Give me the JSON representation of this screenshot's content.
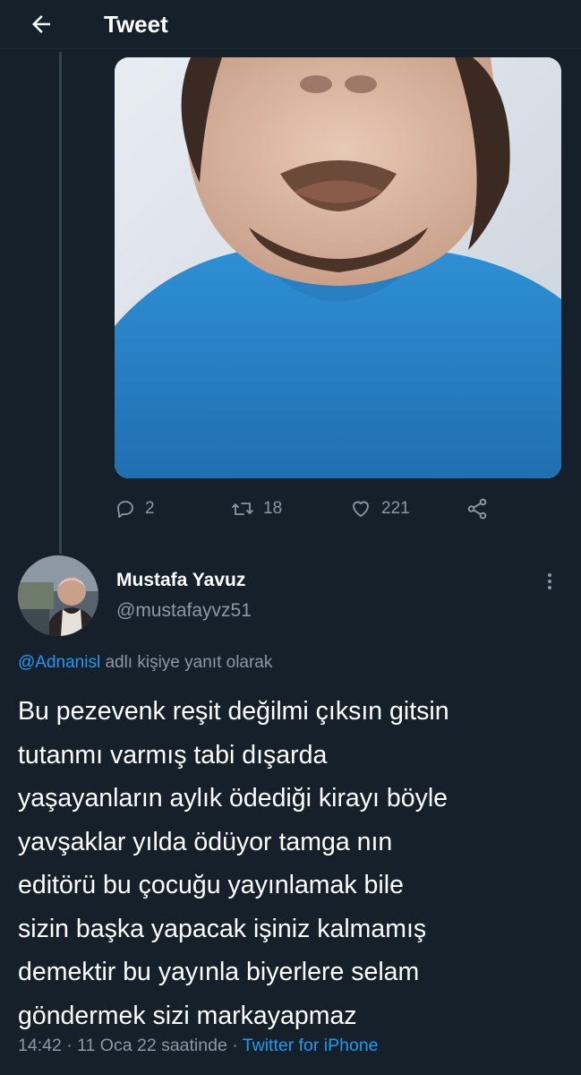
{
  "header": {
    "back_icon": "arrow-left-icon",
    "title": "Tweet"
  },
  "parent_tweet": {
    "media_description": "video frame",
    "actions": {
      "reply": {
        "icon": "reply-bubble-icon",
        "count": "2"
      },
      "retweet": {
        "icon": "retweet-icon",
        "count": "18"
      },
      "like": {
        "icon": "heart-icon",
        "count": "221"
      },
      "share": {
        "icon": "share-icon"
      }
    }
  },
  "tweet": {
    "author": {
      "name": "Mustafa Yavuz",
      "handle": "@mustafayvz51"
    },
    "more_icon": "more-vertical-icon",
    "reply_to": {
      "mention": "@Adnanisl",
      "suffix": " adlı kişiye yanıt olarak"
    },
    "text": "Bu pezevenk reşit değilmi çıksın gitsin\ntutanmı varmış tabi dışarda\nyaşayanların aylık ödediği kirayı böyle\nyavşaklar yılda ödüyor tamga nın\neditörü bu çocuğu yayınlamak bile\nsizin başka yapacak işiniz kalmamış\ndemektir bu yayınla biyerlere selam\ngöndermek sizi markayapmaz",
    "meta": {
      "time_date": "14:42 · 11 Oca 22 saatinde · ",
      "source": "Twitter for iPhone"
    }
  },
  "colors": {
    "background": "#15202b",
    "text_primary": "#ffffff",
    "text_secondary": "#8b98a5",
    "accent": "#1d9bf0"
  }
}
